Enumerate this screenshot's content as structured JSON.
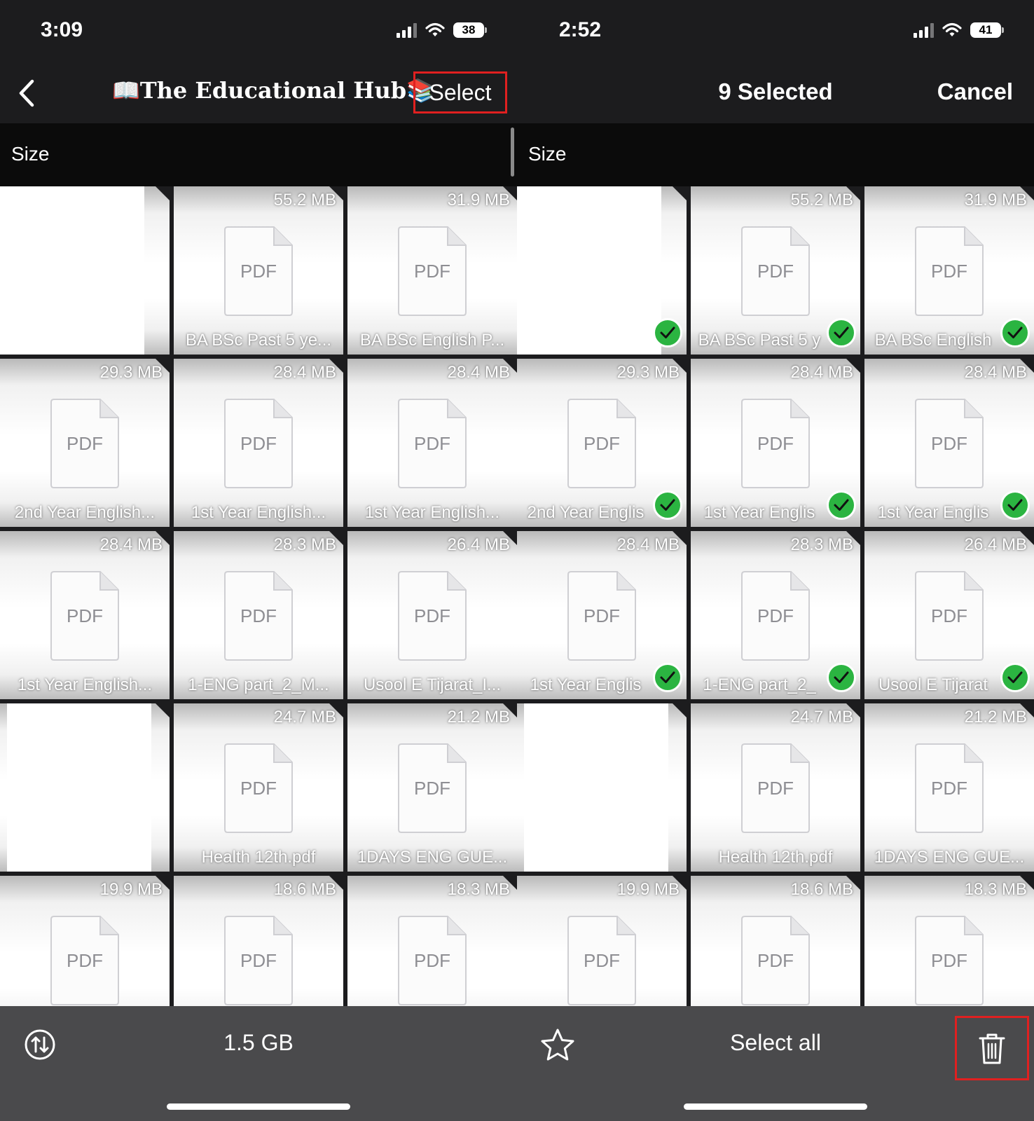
{
  "left": {
    "status": {
      "time": "3:09",
      "battery": "38"
    },
    "nav": {
      "title": "📖The Educational Hub📚",
      "select_label": "Select"
    },
    "sort_label": "Size",
    "files": [
      {
        "size": "",
        "name": "",
        "thumb": true
      },
      {
        "size": "55.2 MB",
        "name": "BA BSc Past 5 ye..."
      },
      {
        "size": "31.9 MB",
        "name": "BA BSc English P..."
      },
      {
        "size": "29.3 MB",
        "name": "2nd Year English..."
      },
      {
        "size": "28.4 MB",
        "name": "1st Year English..."
      },
      {
        "size": "28.4 MB",
        "name": "1st Year English..."
      },
      {
        "size": "28.4 MB",
        "name": "1st Year English..."
      },
      {
        "size": "28.3 MB",
        "name": "1-ENG part_2_M..."
      },
      {
        "size": "26.4 MB",
        "name": "Usool E Tijarat_I..."
      },
      {
        "size": "",
        "name": "",
        "thumb": true
      },
      {
        "size": "24.7 MB",
        "name": "Health 12th.pdf"
      },
      {
        "size": "21.2 MB",
        "name": "1DAYS ENG  GUE..."
      },
      {
        "size": "19.9 MB",
        "name": ""
      },
      {
        "size": "18.6 MB",
        "name": ""
      },
      {
        "size": "18.3 MB",
        "name": ""
      }
    ],
    "toolbar": {
      "storage": "1.5 GB"
    }
  },
  "right": {
    "status": {
      "time": "2:52",
      "battery": "41"
    },
    "nav": {
      "title": "9 Selected",
      "cancel_label": "Cancel"
    },
    "sort_label": "Size",
    "files": [
      {
        "size": "",
        "name": "",
        "thumb": true,
        "selected": true
      },
      {
        "size": "55.2 MB",
        "name": "BA BSc Past 5 y",
        "selected": true
      },
      {
        "size": "31.9 MB",
        "name": "BA BSc English",
        "selected": true
      },
      {
        "size": "29.3 MB",
        "name": "2nd Year Englis",
        "selected": true
      },
      {
        "size": "28.4 MB",
        "name": "1st Year Englis",
        "selected": true
      },
      {
        "size": "28.4 MB",
        "name": "1st Year Englis",
        "selected": true
      },
      {
        "size": "28.4 MB",
        "name": "1st Year Englis",
        "selected": true
      },
      {
        "size": "28.3 MB",
        "name": "1-ENG part_2_",
        "selected": true
      },
      {
        "size": "26.4 MB",
        "name": "Usool E Tijarat",
        "selected": true
      },
      {
        "size": "",
        "name": "",
        "thumb": true
      },
      {
        "size": "24.7 MB",
        "name": "Health 12th.pdf"
      },
      {
        "size": "21.2 MB",
        "name": "1DAYS ENG  GUE..."
      },
      {
        "size": "19.9 MB",
        "name": ""
      },
      {
        "size": "18.6 MB",
        "name": ""
      },
      {
        "size": "18.3 MB",
        "name": ""
      }
    ],
    "toolbar": {
      "select_all_label": "Select all"
    }
  },
  "doc_label": "PDF",
  "icons": {
    "back": "chevron-left-icon",
    "sort": "sort-arrows-icon",
    "favorite": "star-icon",
    "delete": "trash-icon",
    "selected": "checkmark-icon"
  },
  "colors": {
    "accent_green": "#2bb441",
    "highlight_red": "#e02020",
    "background": "#1c1c1e",
    "toolbar": "#4a4a4c"
  }
}
